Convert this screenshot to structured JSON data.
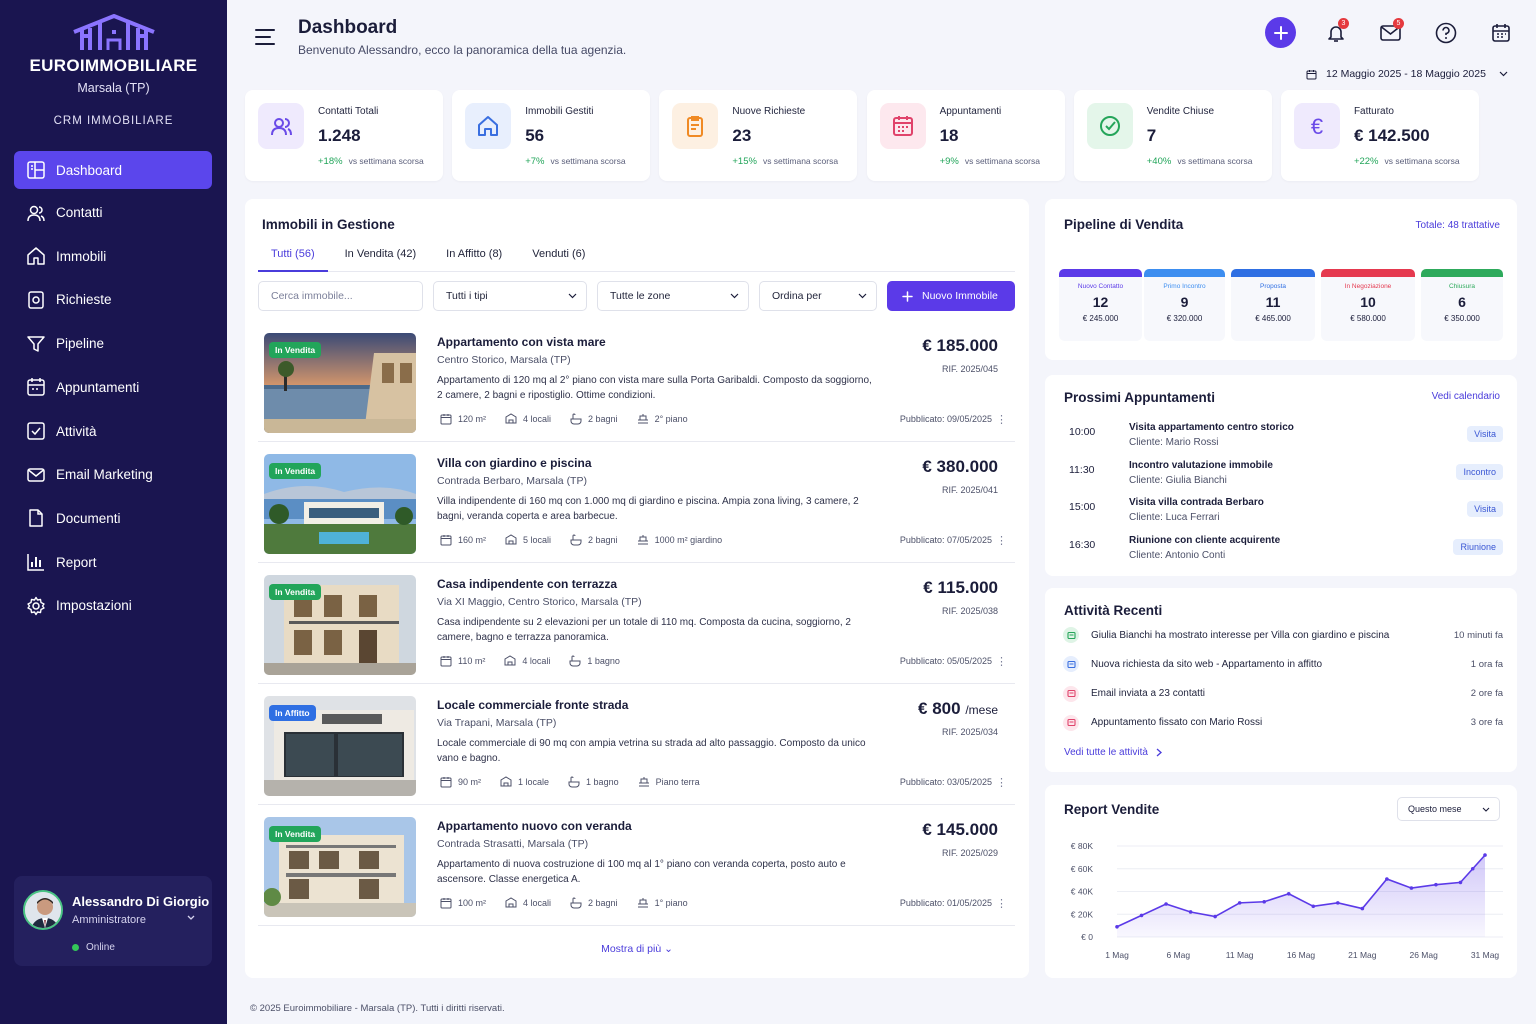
{
  "sidebar": {
    "brand": "EUROIMMOBILIARE",
    "city": "Marsala (TP)",
    "crm": "CRM IMMOBILIARE",
    "items": [
      {
        "label": "Dashboard",
        "icon": "dashboard-icon"
      },
      {
        "label": "Contatti",
        "icon": "users-icon"
      },
      {
        "label": "Immobili",
        "icon": "home-icon"
      },
      {
        "label": "Richieste",
        "icon": "request-icon"
      },
      {
        "label": "Pipeline",
        "icon": "filter-icon"
      },
      {
        "label": "Appuntamenti",
        "icon": "calendar-icon"
      },
      {
        "label": "Attività",
        "icon": "checkbox-icon"
      },
      {
        "label": "Email Marketing",
        "icon": "mail-icon"
      },
      {
        "label": "Documenti",
        "icon": "document-icon"
      },
      {
        "label": "Report",
        "icon": "chart-icon"
      },
      {
        "label": "Impostazioni",
        "icon": "gear-icon"
      }
    ],
    "user": {
      "name": "Alessandro Di Giorgio",
      "role": "Amministratore",
      "status": "Online"
    }
  },
  "header": {
    "title": "Dashboard",
    "subtitle": "Benvenuto Alessandro, ecco la panoramica della tua agenzia.",
    "notifications_count": "3",
    "messages_count": "5",
    "date_range": "12 Maggio 2025 - 18 Maggio 2025"
  },
  "stats": [
    {
      "label": "Contatti Totali",
      "value": "1.248",
      "change": "+18%",
      "note": "vs settimana scorsa",
      "color": "#6a4be8",
      "bg": "#efeafd",
      "icon": "users-icon"
    },
    {
      "label": "Immobili Gestiti",
      "value": "56",
      "change": "+7%",
      "note": "vs settimana scorsa",
      "color": "#3a6fe0",
      "bg": "#e8effd",
      "icon": "home-icon"
    },
    {
      "label": "Nuove Richieste",
      "value": "23",
      "change": "+15%",
      "note": "vs settimana scorsa",
      "color": "#f08a24",
      "bg": "#fdf0e2",
      "icon": "clipboard-icon"
    },
    {
      "label": "Appuntamenti",
      "value": "18",
      "change": "+9%",
      "note": "vs settimana scorsa",
      "color": "#e0436b",
      "bg": "#fde8ee",
      "icon": "calendar-icon"
    },
    {
      "label": "Vendite Chiuse",
      "value": "7",
      "change": "+40%",
      "note": "vs settimana scorsa",
      "color": "#25a55a",
      "bg": "#e4f6ea",
      "icon": "check-circle-icon"
    },
    {
      "label": "Fatturato",
      "value": "€ 142.500",
      "change": "+22%",
      "note": "vs settimana scorsa",
      "color": "#6a4be8",
      "bg": "#efeafd",
      "icon": "euro-icon"
    }
  ],
  "properties": {
    "title": "Immobili in Gestione",
    "tabs": [
      "Tutti (56)",
      "In Vendita (42)",
      "In Affitto (8)",
      "Venduti (6)"
    ],
    "search_placeholder": "Cerca immobile...",
    "filter_type": "Tutti i tipi",
    "filter_zone": "Tutte le zone",
    "sort": "Ordina per",
    "new_button": "Nuovo Immobile",
    "more": "Mostra di più",
    "items": [
      {
        "tag": "In Vendita",
        "tag_color": "#22a55a",
        "title": "Appartamento con vista mare",
        "address": "Centro Storico, Marsala (TP)",
        "desc": "Appartamento di 120 mq al 2° piano con vista mare sulla Porta Garibaldi. Composto da soggiorno, 2 camere, 2 bagni e ripostiglio. Ottime condizioni.",
        "price": "€ 185.000",
        "price_suffix": "",
        "ref": "RIF. 2025/045",
        "meta": [
          "120 m²",
          "4 locali",
          "2 bagni",
          "2° piano"
        ],
        "published": "Pubblicato: 09/05/2025"
      },
      {
        "tag": "In Vendita",
        "tag_color": "#22a55a",
        "title": "Villa con giardino e piscina",
        "address": "Contrada Berbaro, Marsala (TP)",
        "desc": "Villa indipendente di 160 mq con 1.000 mq di giardino e piscina. Ampia zona living, 3 camere, 2 bagni, veranda coperta e area barbecue.",
        "price": "€ 380.000",
        "price_suffix": "",
        "ref": "RIF. 2025/041",
        "meta": [
          "160 m²",
          "5 locali",
          "2 bagni",
          "1000 m² giardino"
        ],
        "published": "Pubblicato: 07/05/2025"
      },
      {
        "tag": "In Vendita",
        "tag_color": "#22a55a",
        "title": "Casa indipendente con terrazza",
        "address": "Via XI Maggio, Centro Storico, Marsala (TP)",
        "desc": "Casa indipendente su 2 elevazioni per un totale di 110 mq. Composta da cucina, soggiorno, 2 camere, bagno e terrazza panoramica.",
        "price": "€ 115.000",
        "price_suffix": "",
        "ref": "RIF. 2025/038",
        "meta": [
          "110 m²",
          "4 locali",
          "1 bagno"
        ],
        "published": "Pubblicato: 05/05/2025"
      },
      {
        "tag": "In Affitto",
        "tag_color": "#2f6fe3",
        "title": "Locale commerciale fronte strada",
        "address": "Via Trapani, Marsala (TP)",
        "desc": "Locale commerciale di 90 mq con ampia vetrina su strada ad alto passaggio. Composto da unico vano e bagno.",
        "price": "€ 800",
        "price_suffix": "/mese",
        "ref": "RIF. 2025/034",
        "meta": [
          "90 m²",
          "1 locale",
          "1 bagno",
          "Piano terra"
        ],
        "published": "Pubblicato: 03/05/2025"
      },
      {
        "tag": "In Vendita",
        "tag_color": "#22a55a",
        "title": "Appartamento nuovo con veranda",
        "address": "Contrada Strasatti, Marsala (TP)",
        "desc": "Appartamento di nuova costruzione di 100 mq al 1° piano con veranda coperta, posto auto e ascensore. Classe energetica A.",
        "price": "€ 145.000",
        "price_suffix": "",
        "ref": "RIF. 2025/029",
        "meta": [
          "100 m²",
          "4 locali",
          "2 bagni",
          "1° piano"
        ],
        "published": "Pubblicato: 01/05/2025"
      }
    ]
  },
  "pipeline": {
    "title": "Pipeline di Vendita",
    "total": "Totale: 48 trattative",
    "stages": [
      {
        "label": "Nuovo Contatto",
        "count": "12",
        "amount": "€ 245.000",
        "color": "#5b3ae8"
      },
      {
        "label": "Primo Incontro",
        "count": "9",
        "amount": "€ 320.000",
        "color": "#3d8ef0"
      },
      {
        "label": "Proposta",
        "count": "11",
        "amount": "€ 465.000",
        "color": "#2f6fe3"
      },
      {
        "label": "In Negoziazione",
        "count": "10",
        "amount": "€ 580.000",
        "color": "#e5394f"
      },
      {
        "label": "Chiusura",
        "count": "6",
        "amount": "€ 350.000",
        "color": "#2eaa5c"
      }
    ]
  },
  "appointments": {
    "title": "Prossimi Appuntamenti",
    "link": "Vedi calendario",
    "items": [
      {
        "time": "10:00",
        "title": "Visita appartamento centro storico",
        "client": "Cliente: Mario Rossi",
        "badge": "Visita"
      },
      {
        "time": "11:30",
        "title": "Incontro valutazione immobile",
        "client": "Cliente: Giulia Bianchi",
        "badge": "Incontro"
      },
      {
        "time": "15:00",
        "title": "Visita villa contrada Berbaro",
        "client": "Cliente: Luca Ferrari",
        "badge": "Visita"
      },
      {
        "time": "16:30",
        "title": "Riunione con cliente acquirente",
        "client": "Cliente: Antonio Conti",
        "badge": "Riunione"
      }
    ]
  },
  "activities": {
    "title": "Attività Recenti",
    "link": "Vedi tutte le attività",
    "items": [
      {
        "text": "Giulia Bianchi ha mostrato interesse per Villa con giardino e piscina",
        "time": "10 minuti fa",
        "color": "#25a55a",
        "bg": "#dff4e6"
      },
      {
        "text": "Nuova richiesta da sito web - Appartamento in affitto",
        "time": "1 ora fa",
        "color": "#3a6fe0",
        "bg": "#e6eefd"
      },
      {
        "text": "Email inviata a 23 contatti",
        "time": "2 ore fa",
        "color": "#e0436b",
        "bg": "#fde6ec"
      },
      {
        "text": "Appuntamento fissato con Mario Rossi",
        "time": "3 ore fa",
        "color": "#e0436b",
        "bg": "#fde6ec"
      }
    ]
  },
  "report": {
    "title": "Report Vendite",
    "period": "Questo mese"
  },
  "chart_data": {
    "type": "area",
    "title": "Report Vendite",
    "x_ticks": [
      "1 Mag",
      "6 Mag",
      "11 Mag",
      "16 Mag",
      "21 Mag",
      "26 Mag",
      "31 Mag"
    ],
    "y_ticks": [
      "€ 80K",
      "€ 60K",
      "€ 40K",
      "€ 20K",
      "€ 0"
    ],
    "ylim": [
      0,
      80000
    ],
    "x": [
      1,
      3,
      5,
      7,
      9,
      11,
      13,
      15,
      17,
      19,
      21,
      23,
      25,
      27,
      29,
      30,
      31
    ],
    "values": [
      9000,
      19000,
      29000,
      22000,
      18000,
      30000,
      31000,
      38000,
      27000,
      30000,
      25000,
      51000,
      43000,
      46000,
      48000,
      60000,
      72000
    ],
    "color": "#5b3ae8"
  },
  "footer": "© 2025 Euroimmobiliare - Marsala (TP). Tutti i diritti riservati."
}
